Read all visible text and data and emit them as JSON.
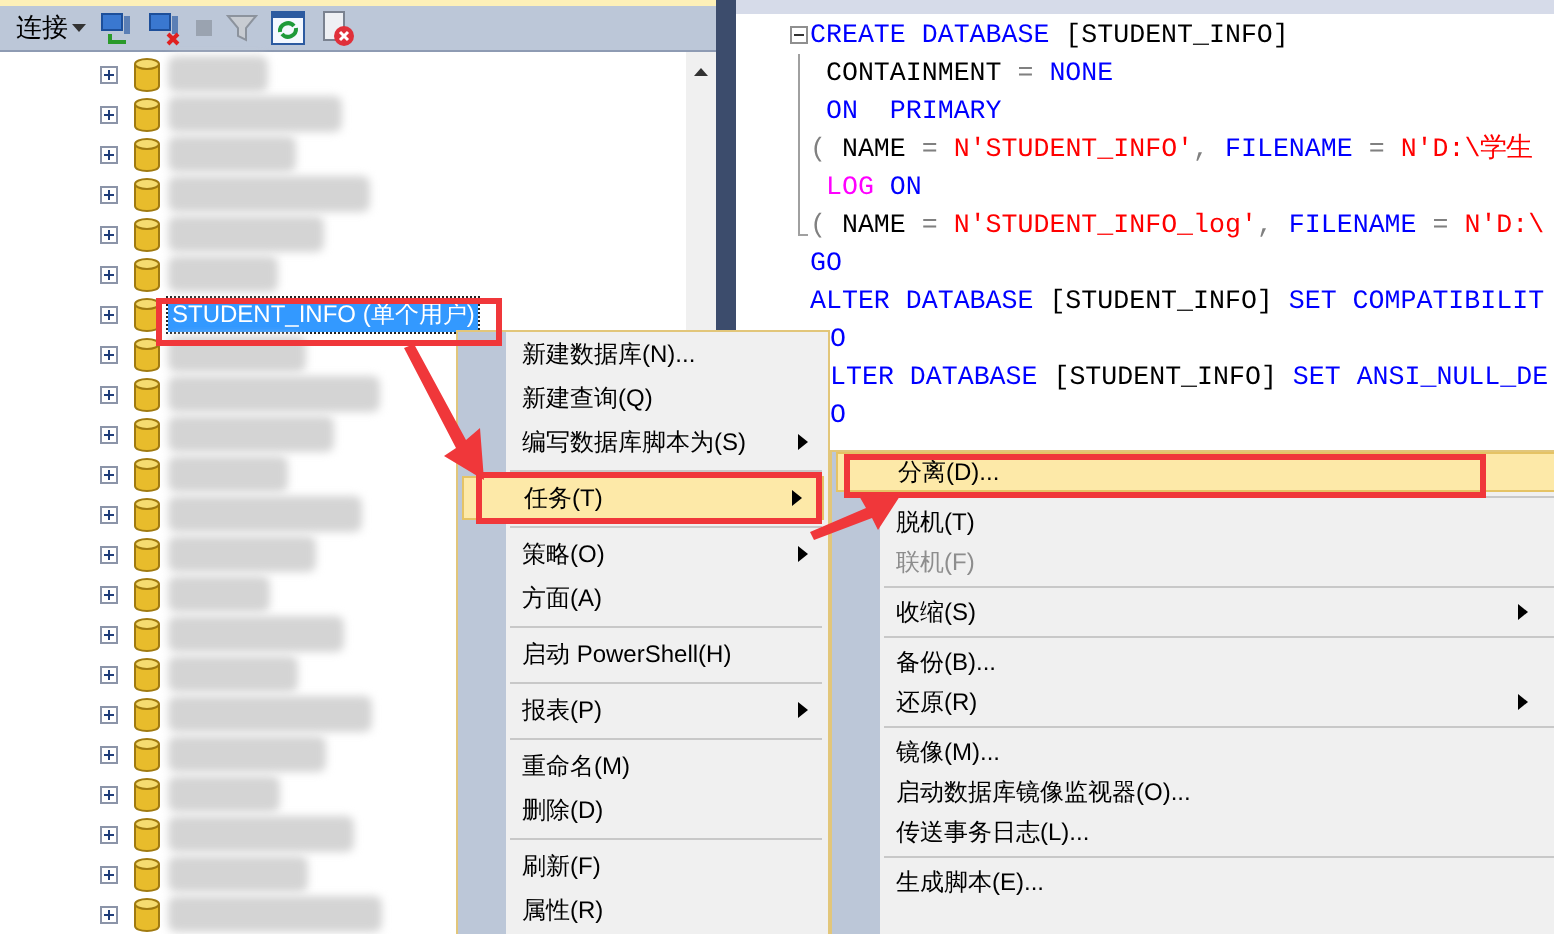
{
  "toolbar": {
    "connect_label": "连接"
  },
  "tree": {
    "items": [
      {
        "kind": "blurred",
        "selected": false
      },
      {
        "kind": "blurred",
        "selected": false
      },
      {
        "kind": "blurred",
        "selected": false
      },
      {
        "kind": "blurred",
        "selected": false
      },
      {
        "kind": "blurred",
        "selected": false
      },
      {
        "kind": "blurred",
        "selected": false
      },
      {
        "kind": "named",
        "selected": true,
        "label": "STUDENT_INFO (单个用户)"
      },
      {
        "kind": "blurred",
        "selected": false
      },
      {
        "kind": "blurred",
        "selected": false
      },
      {
        "kind": "blurred",
        "selected": false
      },
      {
        "kind": "blurred",
        "selected": false
      },
      {
        "kind": "blurred",
        "selected": false
      },
      {
        "kind": "blurred",
        "selected": false
      },
      {
        "kind": "blurred",
        "selected": false
      },
      {
        "kind": "blurred",
        "selected": false
      },
      {
        "kind": "blurred",
        "selected": false
      },
      {
        "kind": "blurred",
        "selected": false
      },
      {
        "kind": "blurred",
        "selected": false
      },
      {
        "kind": "blurred",
        "selected": false
      },
      {
        "kind": "blurred",
        "selected": false
      },
      {
        "kind": "blurred",
        "selected": false
      },
      {
        "kind": "blurred",
        "selected": false
      }
    ]
  },
  "code": {
    "lines": [
      {
        "kind": "fold_start",
        "tokens": [
          {
            "kind": "keyword",
            "text": "CREATE DATABASE"
          },
          {
            "kind": "plain",
            "text": " [STUDENT_INFO]"
          }
        ]
      },
      {
        "kind": "fold_inner",
        "tokens": [
          {
            "kind": "plain",
            "text": " CONTAINMENT "
          },
          {
            "kind": "operator",
            "text": "= "
          },
          {
            "kind": "keyword",
            "text": "NONE"
          }
        ]
      },
      {
        "kind": "fold_inner",
        "tokens": [
          {
            "kind": "keyword",
            "text": " ON  PRIMARY"
          }
        ]
      },
      {
        "kind": "fold_inner",
        "tokens": [
          {
            "kind": "operator",
            "text": "( "
          },
          {
            "kind": "plain",
            "text": "NAME "
          },
          {
            "kind": "operator",
            "text": "= "
          },
          {
            "kind": "string",
            "text": "N'STUDENT_INFO'"
          },
          {
            "kind": "operator",
            "text": ", "
          },
          {
            "kind": "keyword",
            "text": "FILENAME "
          },
          {
            "kind": "operator",
            "text": "= "
          },
          {
            "kind": "string",
            "text": "N'D:\\学生"
          }
        ]
      },
      {
        "kind": "fold_inner",
        "tokens": [
          {
            "kind": "function",
            "text": " LOG"
          },
          {
            "kind": "keyword",
            "text": " ON"
          }
        ]
      },
      {
        "kind": "fold_end",
        "tokens": [
          {
            "kind": "operator",
            "text": "( "
          },
          {
            "kind": "plain",
            "text": "NAME "
          },
          {
            "kind": "operator",
            "text": "= "
          },
          {
            "kind": "string",
            "text": "N'STUDENT_INFO_log'"
          },
          {
            "kind": "operator",
            "text": ", "
          },
          {
            "kind": "keyword",
            "text": "FILENAME "
          },
          {
            "kind": "operator",
            "text": "= "
          },
          {
            "kind": "string",
            "text": "N'D:\\"
          }
        ]
      },
      {
        "kind": "plain",
        "tokens": [
          {
            "kind": "keyword",
            "text": "GO"
          }
        ]
      },
      {
        "kind": "plain",
        "tokens": [
          {
            "kind": "keyword",
            "text": "ALTER DATABASE"
          },
          {
            "kind": "plain",
            "text": " [STUDENT_INFO] "
          },
          {
            "kind": "keyword",
            "text": "SET COMPATIBILIT"
          }
        ]
      },
      {
        "kind": "clipped",
        "tokens": [
          {
            "kind": "keyword",
            "text": "O"
          }
        ]
      },
      {
        "kind": "clipped",
        "tokens": [
          {
            "kind": "keyword",
            "text": "LTER DATABASE"
          },
          {
            "kind": "plain",
            "text": " [STUDENT_INFO] "
          },
          {
            "kind": "keyword",
            "text": "SET ANSI_NULL_DE"
          }
        ]
      },
      {
        "kind": "clipped",
        "tokens": [
          {
            "kind": "keyword",
            "text": "O"
          }
        ]
      }
    ]
  },
  "context_menu": {
    "items": [
      {
        "kind": "item",
        "label": "新建数据库(N)...",
        "submenu": false,
        "selected": false
      },
      {
        "kind": "item",
        "label": "新建查询(Q)",
        "submenu": false,
        "selected": false
      },
      {
        "kind": "item",
        "label": "编写数据库脚本为(S)",
        "submenu": true,
        "selected": false
      },
      {
        "kind": "separator"
      },
      {
        "kind": "item",
        "label": "任务(T)",
        "submenu": true,
        "selected": true
      },
      {
        "kind": "separator"
      },
      {
        "kind": "item",
        "label": "策略(O)",
        "submenu": true,
        "selected": false
      },
      {
        "kind": "item",
        "label": "方面(A)",
        "submenu": false,
        "selected": false
      },
      {
        "kind": "separator"
      },
      {
        "kind": "item",
        "label": "启动 PowerShell(H)",
        "submenu": false,
        "selected": false
      },
      {
        "kind": "separator"
      },
      {
        "kind": "item",
        "label": "报表(P)",
        "submenu": true,
        "selected": false
      },
      {
        "kind": "separator"
      },
      {
        "kind": "item",
        "label": "重命名(M)",
        "submenu": false,
        "selected": false
      },
      {
        "kind": "item",
        "label": "删除(D)",
        "submenu": false,
        "selected": false
      },
      {
        "kind": "separator"
      },
      {
        "kind": "item",
        "label": "刷新(F)",
        "submenu": false,
        "selected": false
      },
      {
        "kind": "item",
        "label": "属性(R)",
        "submenu": false,
        "selected": false
      }
    ]
  },
  "submenu": {
    "items": [
      {
        "kind": "item",
        "label": "分离(D)...",
        "submenu": false,
        "selected": true,
        "disabled": false
      },
      {
        "kind": "separator"
      },
      {
        "kind": "item",
        "label": "脱机(T)",
        "submenu": false,
        "selected": false,
        "disabled": false
      },
      {
        "kind": "item",
        "label": "联机(F)",
        "submenu": false,
        "selected": false,
        "disabled": true
      },
      {
        "kind": "separator"
      },
      {
        "kind": "item",
        "label": "收缩(S)",
        "submenu": true,
        "selected": false,
        "disabled": false
      },
      {
        "kind": "separator"
      },
      {
        "kind": "item",
        "label": "备份(B)...",
        "submenu": false,
        "selected": false,
        "disabled": false
      },
      {
        "kind": "item",
        "label": "还原(R)",
        "submenu": true,
        "selected": false,
        "disabled": false
      },
      {
        "kind": "separator"
      },
      {
        "kind": "item",
        "label": "镜像(M)...",
        "submenu": false,
        "selected": false,
        "disabled": false
      },
      {
        "kind": "item",
        "label": "启动数据库镜像监视器(O)...",
        "submenu": false,
        "selected": false,
        "disabled": false
      },
      {
        "kind": "item",
        "label": "传送事务日志(L)...",
        "submenu": false,
        "selected": false,
        "disabled": false
      },
      {
        "kind": "separator"
      },
      {
        "kind": "item",
        "label": "生成脚本(E)...",
        "submenu": false,
        "selected": false,
        "disabled": false
      }
    ]
  }
}
